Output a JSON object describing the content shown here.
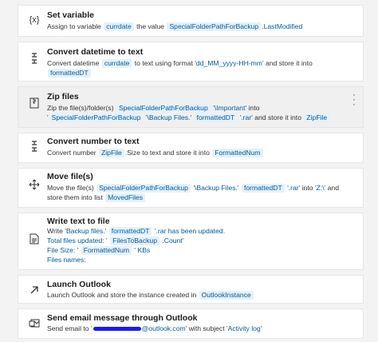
{
  "steps": [
    {
      "title": "Set variable",
      "icon": "variable-icon",
      "p1": "Assign to variable",
      "v1": "currdate",
      "p2": "the value",
      "v2": "SpecialFolderPathForBackup",
      "p3": ".LastModified"
    },
    {
      "title": "Convert datetime to text",
      "icon": "convert-icon",
      "p1": "Convert datetime",
      "v1": "currdate",
      "p2": "to text using format",
      "s1": "'dd_MM_yyyy-HH-mm'",
      "p3": "and store it into",
      "v2": "formattedDT"
    },
    {
      "title": "Zip files",
      "icon": "zip-icon",
      "p1": "Zip the file(s)/folder(s)",
      "v1": "SpecialFolderPathForBackup",
      "s1": "'\\Important'",
      "p2": "into",
      "s2": "'",
      "v2": "SpecialFolderPathForBackup",
      "s3": "'\\Backup Files.'",
      "v3": "formattedDT",
      "s4": "'.rar'",
      "p3": "and store it into",
      "v4": "ZipFile"
    },
    {
      "title": "Convert number to text",
      "icon": "convert-icon",
      "p1": "Convert number",
      "v1": "ZipFile",
      "p2": ".Size to text and store it into",
      "v2": "FormattedNum"
    },
    {
      "title": "Move file(s)",
      "icon": "move-icon",
      "p1": "Move the file(s)",
      "v1": "SpecialFolderPathForBackup",
      "s1": "'\\Backup Files.'",
      "v2": "formattedDT",
      "s2": "'.rar'",
      "p2": "into",
      "s3": "'Z:\\'",
      "p3": "and",
      "p4": "store them into list",
      "v3": "MovedFiles"
    },
    {
      "title": "Write text to file",
      "icon": "write-file-icon",
      "p1": "Write",
      "s1": "'Backup files.'",
      "v1": "formattedDT",
      "s2": "'.rar has been updated.",
      "s3": "Total files updated: '",
      "v2": "FilesToBackup",
      "s4": ".Count'",
      "s5": "File Size: '",
      "v3": "FormattedNum",
      "s6": "' KBs",
      "s7": "Files names:"
    },
    {
      "title": "Launch Outlook",
      "icon": "launch-icon",
      "p1": "Launch Outlook and store the instance created in",
      "v1": "OutlookInstance"
    },
    {
      "title": "Send email message through Outlook",
      "icon": "email-icon",
      "p1": "Send email to",
      "s1": "'",
      "s2": "@outlook.com'",
      "p2": "with subject",
      "s3": "'Activity log'"
    }
  ]
}
